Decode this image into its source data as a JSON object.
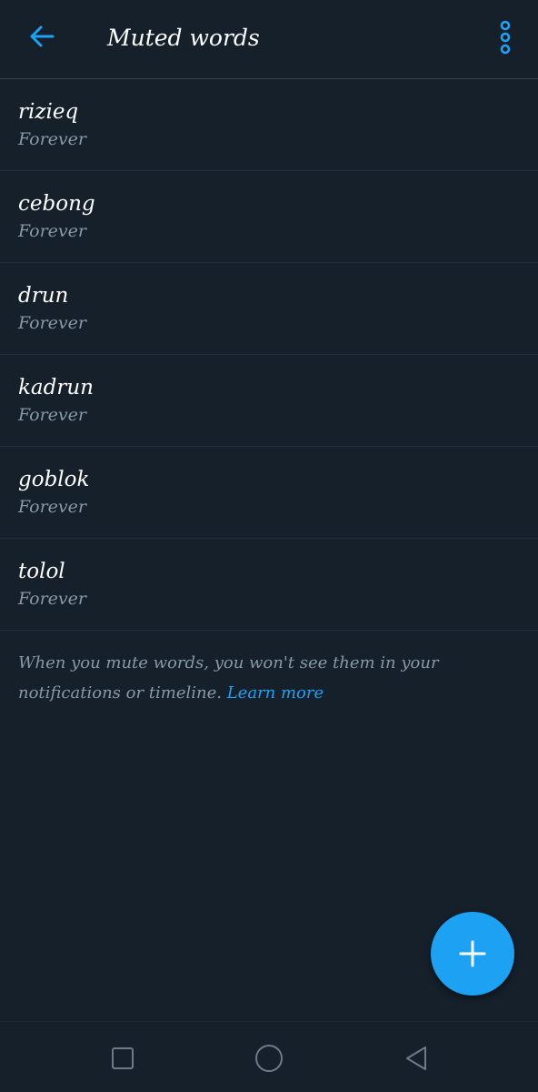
{
  "header": {
    "title": "Muted words",
    "back_icon": "arrow-left-icon",
    "more_icon": "more-vertical-icon"
  },
  "muted_words": [
    {
      "word": "rizieq",
      "duration": "Forever"
    },
    {
      "word": "cebong",
      "duration": "Forever"
    },
    {
      "word": "drun",
      "duration": "Forever"
    },
    {
      "word": "kadrun",
      "duration": "Forever"
    },
    {
      "word": "goblok",
      "duration": "Forever"
    },
    {
      "word": "tolol",
      "duration": "Forever"
    }
  ],
  "info": {
    "text": "When you mute words, you won't see them in your notifications or timeline.",
    "link": "Learn more"
  },
  "fab": {
    "icon": "plus-icon"
  },
  "nav": {
    "recents_icon": "square-icon",
    "home_icon": "circle-icon",
    "back_icon": "triangle-back-icon"
  },
  "colors": {
    "background": "#15202b",
    "accent": "#1da1f2",
    "secondary_text": "#8899a6",
    "divider": "#38444d"
  }
}
